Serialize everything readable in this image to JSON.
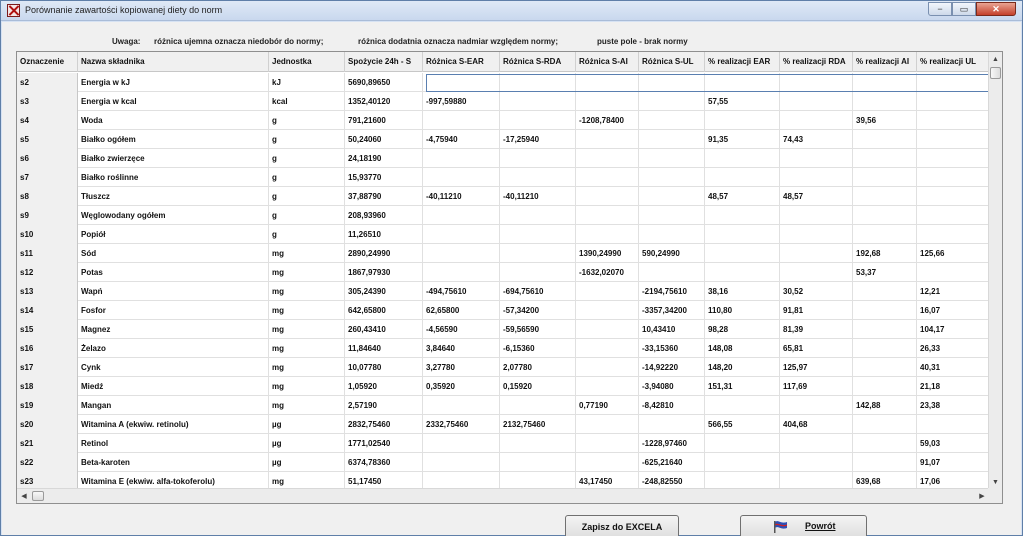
{
  "window": {
    "title": "Porównanie zawartości kopiowanej diety  do norm",
    "controls": {
      "minimize": "−",
      "maximize": "▭",
      "close": "✕"
    }
  },
  "legend": {
    "label": "Uwaga:",
    "negative": "różnica ujemna oznacza niedobór do normy;",
    "positive": "różnica dodatnia oznacza nadmiar względem normy;",
    "empty": "puste pole - brak normy"
  },
  "table": {
    "columns": [
      "Oznaczenie",
      "Nazwa składnika",
      "Jednostka",
      "Spożycie 24h - S",
      "Różnica S-EAR",
      "Różnica S-RDA",
      "Różnica S-AI",
      "Różnica S-UL",
      "% realizacji EAR",
      "% realizacji RDA",
      "% realizacji AI",
      "% realizacji UL"
    ],
    "rows": [
      [
        "s2",
        "Energia w kJ",
        "kJ",
        "5690,89650",
        "",
        "",
        "",
        "",
        "",
        "",
        "",
        ""
      ],
      [
        "s3",
        "Energia w kcal",
        "kcal",
        "1352,40120",
        "-997,59880",
        "",
        "",
        "",
        "57,55",
        "",
        "",
        ""
      ],
      [
        "s4",
        "Woda",
        "g",
        "791,21600",
        "",
        "",
        "-1208,78400",
        "",
        "",
        "",
        "39,56",
        ""
      ],
      [
        "s5",
        "Białko ogółem",
        "g",
        "50,24060",
        "-4,75940",
        "-17,25940",
        "",
        "",
        "91,35",
        "74,43",
        "",
        ""
      ],
      [
        "s6",
        "Białko zwierzęce",
        "g",
        "24,18190",
        "",
        "",
        "",
        "",
        "",
        "",
        "",
        ""
      ],
      [
        "s7",
        "Białko roślinne",
        "g",
        "15,93770",
        "",
        "",
        "",
        "",
        "",
        "",
        "",
        ""
      ],
      [
        "s8",
        "Tłuszcz",
        "g",
        "37,88790",
        "-40,11210",
        "-40,11210",
        "",
        "",
        "48,57",
        "48,57",
        "",
        ""
      ],
      [
        "s9",
        "Węglowodany ogółem",
        "g",
        "208,93960",
        "",
        "",
        "",
        "",
        "",
        "",
        "",
        ""
      ],
      [
        "s10",
        "Popiół",
        "g",
        "11,26510",
        "",
        "",
        "",
        "",
        "",
        "",
        "",
        ""
      ],
      [
        "s11",
        "Sód",
        "mg",
        "2890,24990",
        "",
        "",
        "1390,24990",
        "590,24990",
        "",
        "",
        "192,68",
        "125,66"
      ],
      [
        "s12",
        "Potas",
        "mg",
        "1867,97930",
        "",
        "",
        "-1632,02070",
        "",
        "",
        "",
        "53,37",
        ""
      ],
      [
        "s13",
        "Wapń",
        "mg",
        "305,24390",
        "-494,75610",
        "-694,75610",
        "",
        "-2194,75610",
        "38,16",
        "30,52",
        "",
        "12,21"
      ],
      [
        "s14",
        "Fosfor",
        "mg",
        "642,65800",
        "62,65800",
        "-57,34200",
        "",
        "-3357,34200",
        "110,80",
        "91,81",
        "",
        "16,07"
      ],
      [
        "s15",
        "Magnez",
        "mg",
        "260,43410",
        "-4,56590",
        "-59,56590",
        "",
        "10,43410",
        "98,28",
        "81,39",
        "",
        "104,17"
      ],
      [
        "s16",
        "Żelazo",
        "mg",
        "11,84640",
        "3,84640",
        "-6,15360",
        "",
        "-33,15360",
        "148,08",
        "65,81",
        "",
        "26,33"
      ],
      [
        "s17",
        "Cynk",
        "mg",
        "10,07780",
        "3,27780",
        "2,07780",
        "",
        "-14,92220",
        "148,20",
        "125,97",
        "",
        "40,31"
      ],
      [
        "s18",
        "Miedź",
        "mg",
        "1,05920",
        "0,35920",
        "0,15920",
        "",
        "-3,94080",
        "151,31",
        "117,69",
        "",
        "21,18"
      ],
      [
        "s19",
        "Mangan",
        "mg",
        "2,57190",
        "",
        "",
        "0,77190",
        "-8,42810",
        "",
        "",
        "142,88",
        "23,38"
      ],
      [
        "s20",
        "Witamina A (ekwiw. retinolu)",
        "µg",
        "2832,75460",
        "2332,75460",
        "2132,75460",
        "",
        "",
        "566,55",
        "404,68",
        "",
        ""
      ],
      [
        "s21",
        "Retinol",
        "µg",
        "1771,02540",
        "",
        "",
        "",
        "-1228,97460",
        "",
        "",
        "",
        "59,03"
      ],
      [
        "s22",
        "Beta-karoten",
        "µg",
        "6374,78360",
        "",
        "",
        "",
        "-625,21640",
        "",
        "",
        "",
        "91,07"
      ],
      [
        "s23",
        "Witamina E (ekwiw. alfa-tokoferolu)",
        "mg",
        "51,17450",
        "",
        "",
        "43,17450",
        "-248,82550",
        "",
        "",
        "639,68",
        "17,06"
      ]
    ]
  },
  "buttons": {
    "excel": "Zapisz do EXCELA",
    "back": "Powrót"
  },
  "icons": {
    "app": "app-cross-icon",
    "back": "flag-back-icon",
    "scroll_up": "▲",
    "scroll_down": "▼",
    "scroll_left": "◀",
    "scroll_right": "▶"
  }
}
